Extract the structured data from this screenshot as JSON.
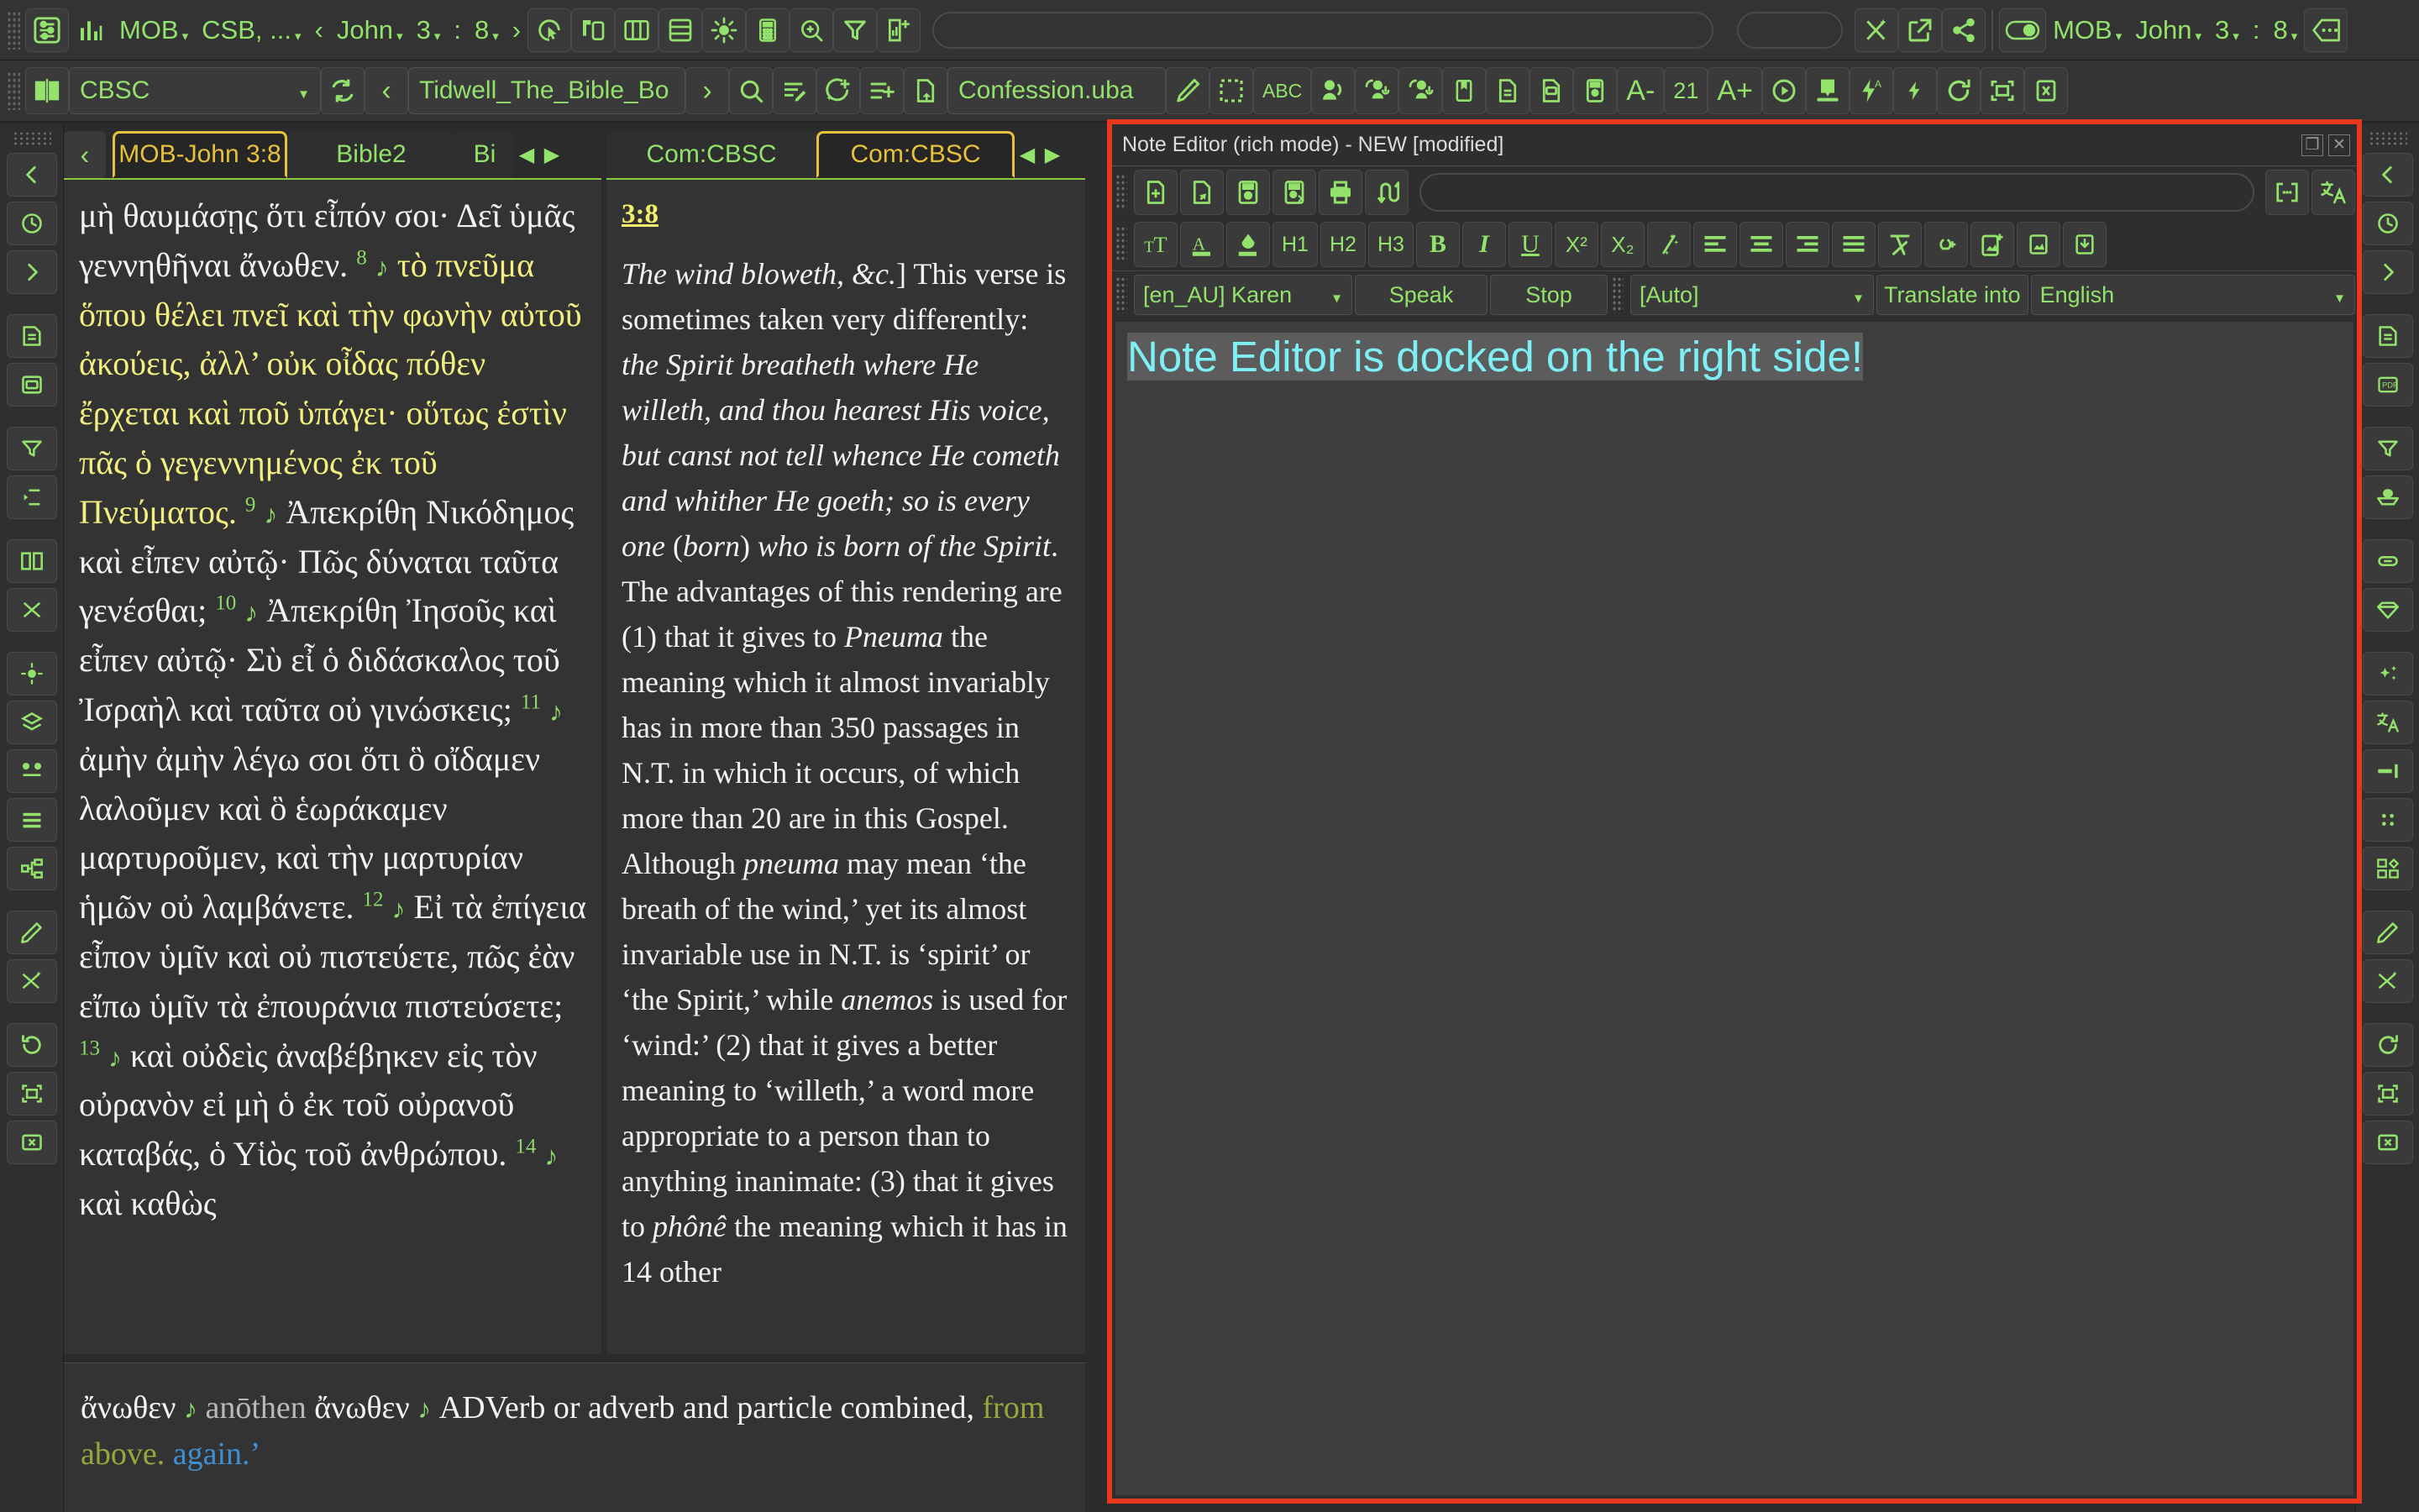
{
  "toolbar_main": {
    "icons_left": [
      "settings-sliders-icon",
      "bar-chart-icon"
    ],
    "chips": [
      {
        "name": "bible-version-chip",
        "label": "MOB"
      },
      {
        "name": "compare-versions-chip",
        "label": "CSB, ..."
      }
    ],
    "prev_label": "‹",
    "next_label": "›",
    "ref_parts": [
      {
        "name": "book-chip",
        "label": "John"
      },
      {
        "name": "chapter-chip",
        "label": "3"
      },
      {
        "name": "colon-separator",
        "label": ":"
      },
      {
        "name": "verse-chip",
        "label": "8"
      }
    ],
    "icons_mid": [
      "click-select-icon",
      "parallel-windows-icon",
      "columns-layout-icon",
      "rows-layout-icon",
      "brightness-icon",
      "calculator-icon",
      "zoom-in-icon",
      "filter-icon",
      "add-chart-icon"
    ],
    "icons_right": [
      "shuffle-sparkle-icon",
      "open-external-icon",
      "share-icon"
    ],
    "toggle_name": "sync-toggle",
    "right_chips": [
      {
        "name": "right-version-chip",
        "label": "MOB"
      },
      {
        "name": "right-book-chip",
        "label": "John"
      },
      {
        "name": "right-chapter-chip",
        "label": "3"
      },
      {
        "name": "right-colon",
        "label": ":"
      },
      {
        "name": "right-verse-chip",
        "label": "8"
      }
    ],
    "overflow_label": "more-options-icon"
  },
  "toolbar_second": {
    "book_icon": "open-book-icon",
    "resource_select": "CBSC",
    "reload_icon": "reload-icon",
    "prev_label": "‹",
    "document_select": "Tidwell_The_Bible_Bo",
    "next_label": "›",
    "icons_a": [
      "search-icon",
      "edit-list-icon",
      "magic-add-icon",
      "add-list-icon",
      "import-doc-icon"
    ],
    "file_label": "Confession.uba",
    "icons_b": [
      "pencil-icon",
      "select-region-icon",
      "abc-icon",
      "speak-icon",
      "speak-group-icon",
      "speak-group2-icon",
      "bookmark-icon",
      "document-icon",
      "pdf-icon",
      "save-doc-icon"
    ],
    "font_dec": "A-",
    "font_size": "21",
    "font_inc": "A+",
    "icons_c": [
      "play-icon",
      "download-icon",
      "auto-flash-icon",
      "flash-icon",
      "refresh-icon",
      "fullscreen-icon",
      "close-icon"
    ]
  },
  "rail_left": {
    "items": [
      "collapse-left-icon",
      "history-icon",
      "expand-right-icon",
      "document-outline-icon",
      "pdf-export-icon",
      "presentation-icon",
      "indent-icon",
      "compare-icon",
      "crosslink-icon",
      "brightness-icon",
      "layers-icon",
      "nodes-icon",
      "list-lines-icon",
      "tree-icon",
      "pencil-edit-icon",
      "shuffle-sparkle-icon",
      "refresh-icon",
      "fullscreen-icon",
      "close-icon"
    ]
  },
  "rail_right": {
    "items": [
      "collapse-left-icon",
      "history-icon",
      "expand-right-icon",
      "document-outline-icon",
      "pdf-export-icon",
      "funnel-icon",
      "hand-book-icon",
      "crosslink-icon",
      "gem-icon",
      "sparkles-icon",
      "translate-icon",
      "align-icon",
      "dots-grid-icon",
      "blocks-icon",
      "pencil-edit-icon",
      "shuffle-sparkle-icon",
      "refresh-icon",
      "fullscreen-icon",
      "close-icon"
    ]
  },
  "tabs_left": {
    "back_arrow": "‹",
    "items": [
      {
        "label": "MOB-John 3:8",
        "active": true
      },
      {
        "label": "Bible2",
        "active": false
      },
      {
        "label": "Bi",
        "active": false
      }
    ],
    "scroll_prev": "◀",
    "scroll_next": "▶"
  },
  "tabs_mid": {
    "items": [
      {
        "label": "Com:CBSC",
        "active": false
      },
      {
        "label": "Com:CBSC",
        "active": true
      }
    ],
    "scroll_prev": "◀",
    "scroll_next": "▶"
  },
  "greek_panel": {
    "lines": [
      {
        "t": "μὴ θαυμάσῃς ὅτι εἶπόν σοι·",
        "c": "white"
      },
      {
        "t": "Δεῖ ὑμᾶς γεννηθῆναι ἄνωθεν.",
        "c": "white",
        "vnum": "8"
      },
      {
        "t": "τὸ πνεῦμα ὅπου θέλει πνεῖ",
        "c": "yellow",
        "note": true
      },
      {
        "t": "καὶ τὴν φωνὴν αὐτοῦ ἀκούεις,",
        "c": "yellow"
      },
      {
        "t": "ἀλλ’ οὐκ οἶδας πόθεν ἔρχεται",
        "c": "yellow"
      },
      {
        "t": "καὶ ποῦ ὑπάγει· οὕτως ἐστὶν",
        "c": "yellow"
      },
      {
        "t": "πᾶς ὁ γεγεννημένος ἐκ τοῦ",
        "c": "yellow"
      },
      {
        "t": "Πνεύματος.",
        "c": "yellow",
        "vnum": "9",
        "note_after": true,
        "tail": "Ἀπεκρίθη"
      },
      {
        "t": "Νικόδημος καὶ εἶπεν αὐτῷ·",
        "c": "white"
      },
      {
        "t": "Πῶς δύναται ταῦτα γενέσθαι;",
        "c": "white"
      },
      {
        "t": "",
        "c": "white",
        "vnum_lead": "10",
        "note": true,
        "tail": "Ἀπεκρίθη Ἰησοῦς καὶ"
      },
      {
        "t": "εἶπεν αὐτῷ· Σὺ εἶ ὁ διδάσκαλος",
        "c": "white"
      },
      {
        "t": "τοῦ Ἰσραὴλ καὶ ταῦτα οὐ",
        "c": "white"
      },
      {
        "t": "γινώσκεις;",
        "c": "white",
        "vnum": "11",
        "note_after": true,
        "tail": "ἀμὴν ἀμὴν"
      },
      {
        "t": "λέγω σοι ὅτι ὃ οἴδαμεν",
        "c": "white"
      },
      {
        "t": "λαλοῦμεν καὶ ὃ ἑωράκαμεν",
        "c": "white"
      },
      {
        "t": "μαρτυροῦμεν, καὶ τὴν",
        "c": "white"
      },
      {
        "t": "μαρτυρίαν ἡμῶν οὐ",
        "c": "white"
      },
      {
        "t": "λαμβάνετε.",
        "c": "white",
        "vnum": "12",
        "note_after": true,
        "tail": "Εἰ τὰ ἐπίγεια"
      },
      {
        "t": "εἶπον ὑμῖν καὶ οὐ πιστεύετε,",
        "c": "white"
      },
      {
        "t": "πῶς ἐὰν εἴπω ὑμῖν τὰ",
        "c": "white"
      },
      {
        "t": "ἐπουράνια πιστεύσετε;",
        "c": "white",
        "vnum": "13",
        "note_after": true,
        "tail": "καὶ"
      },
      {
        "t": "οὐδεὶς ἀναβέβηκεν εἰς τὸν",
        "c": "white"
      },
      {
        "t": "οὐρανὸν εἰ μὴ ὁ ἐκ τοῦ",
        "c": "white"
      },
      {
        "t": "οὐρανοῦ καταβάς, ὁ Υἱὸς τοῦ",
        "c": "white"
      },
      {
        "t": "ἀνθρώπου.",
        "c": "white",
        "vnum": "14",
        "note_after": true,
        "tail": "καὶ καθὼς"
      }
    ]
  },
  "commentary_panel": {
    "reference": "3:8",
    "paragraph_html": "<i>The wind bloweth, &amp;c.</i>] This verse is sometimes taken very differently: <i>the Spirit breatheth where He willeth, and thou hearest His voice, but canst not tell whence He cometh and whither He goeth; so is every one</i> (<i>born</i>) <i>who is born of the Spirit</i>. The advantages of this rendering are (1) that it gives to <i>Pneuma</i> the meaning which it almost invariably has in more than 350 passages in N.T. in which it occurs, of which more than 20 are in this Gospel. Although <i>pneuma</i> may mean ‘the breath of the wind,’ yet its almost invariable use in N.T. is ‘spirit’ or ‘the Spirit,’ while <i>anemos</i> is used for ‘wind:’ (2) that it gives a better meaning to ‘willeth,’ a word more appropriate to a person than to anything inanimate: (3) that it gives to <i>phônê</i> the meaning which it has in 14 other"
  },
  "lexicon_panel": {
    "headword": "ἄνωθεν",
    "transliteration": "anōthen",
    "greek_repeat": "ἄνωθεν",
    "parsing": "ADVerb or adverb and particle combined,",
    "gloss_primary": "from above.",
    "gloss_secondary": "again.’"
  },
  "note_editor": {
    "title": "Note Editor (rich mode) - NEW [modified]",
    "window_buttons": [
      "restore-icon",
      "close-icon"
    ],
    "file_toolbar": {
      "icons": [
        "new-note-icon",
        "open-note-icon",
        "save-note-icon",
        "save-as-note-icon",
        "print-icon",
        "swap-icon"
      ],
      "filename_value": "",
      "right_icons": [
        "brackets-icon",
        "translate-icon"
      ]
    },
    "format_toolbar": {
      "icons": [
        "font-size-icon",
        "font-color-icon",
        "highlight-color-icon",
        "heading1-icon",
        "heading2-icon",
        "heading3-icon",
        "bold-icon",
        "italic-icon",
        "underline-icon",
        "superscript-icon",
        "subscript-icon",
        "clear-format-icon",
        "align-left-icon",
        "align-center-icon",
        "align-right-icon",
        "align-justify-icon",
        "remove-format-icon",
        "insert-link-icon",
        "insert-image-file-icon",
        "insert-image-icon",
        "insert-download-icon"
      ],
      "heading_labels": [
        "H1",
        "H2",
        "H3"
      ],
      "bold_label": "B",
      "italic_label": "I",
      "underline_label": "U",
      "superscript_label": "X²",
      "subscript_label": "X₂"
    },
    "tts_toolbar": {
      "voice_value": "[en_AU] Karen",
      "speak_label": "Speak",
      "stop_label": "Stop",
      "source_language_value": "[Auto]",
      "translate_into_label": "Translate into",
      "target_language_value": "English"
    },
    "body_text": "Note Editor is docked on the right side!"
  }
}
